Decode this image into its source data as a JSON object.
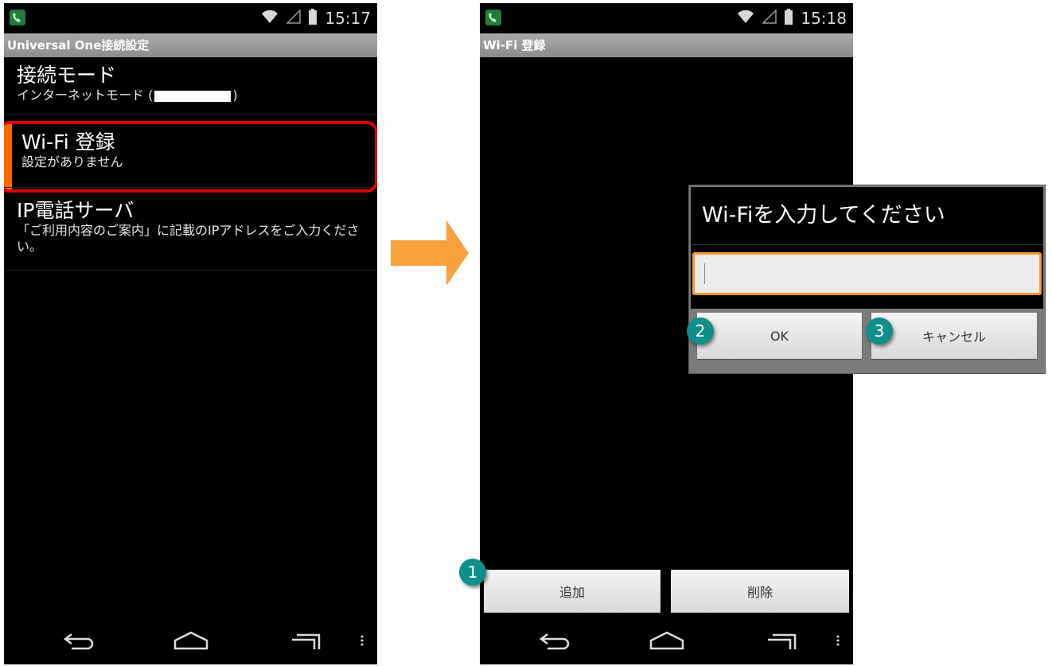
{
  "screen1": {
    "status_time": "15:17",
    "title": "Universal One接続設定",
    "items": [
      {
        "title": "接続モード",
        "summary_prefix": "インターネットモード (",
        "summary_suffix": ")"
      },
      {
        "title": "Wi-Fi 登録",
        "summary": "設定がありません"
      },
      {
        "title": "IP電話サーバ",
        "summary": "「ご利用内容のご案内」に記載のIPアドレスをご入力ください。"
      }
    ]
  },
  "screen2": {
    "status_time": "15:18",
    "title": "Wi-Fi 登録",
    "add_label": "追加",
    "delete_label": "削除"
  },
  "dialog": {
    "title": "Wi-Fiを入力してください",
    "input_value": "",
    "ok_label": "OK",
    "cancel_label": "キャンセル"
  },
  "badges": [
    "1",
    "2",
    "3"
  ],
  "colors": {
    "highlight": "#e00000",
    "accent_orange": "#ff6a00",
    "arrow": "#f7a03c",
    "badge": "#0f8e8a"
  }
}
